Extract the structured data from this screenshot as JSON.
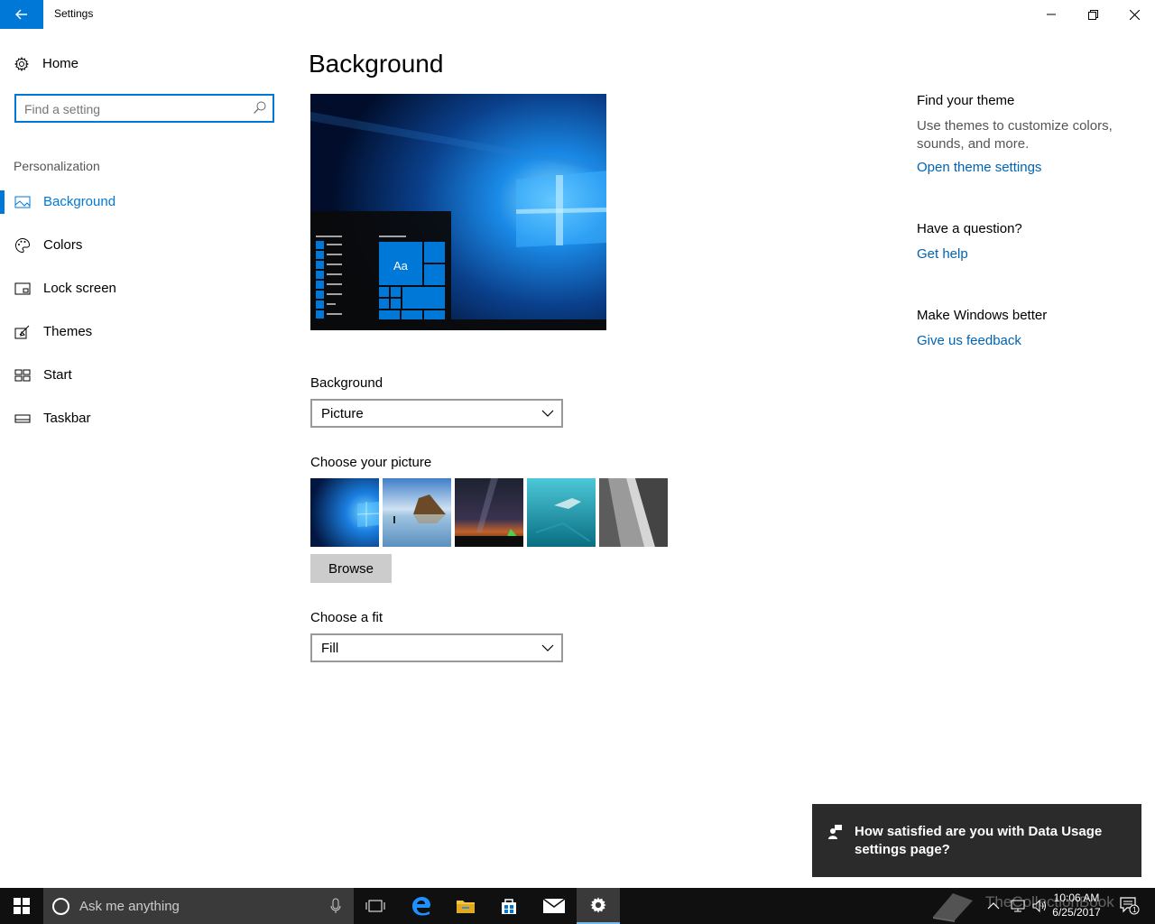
{
  "window": {
    "title": "Settings"
  },
  "sidebar": {
    "home_label": "Home",
    "search_placeholder": "Find a setting",
    "section": "Personalization",
    "items": [
      {
        "label": "Background",
        "icon": "picture-icon",
        "active": true
      },
      {
        "label": "Colors",
        "icon": "palette-icon"
      },
      {
        "label": "Lock screen",
        "icon": "lock-screen-icon"
      },
      {
        "label": "Themes",
        "icon": "themes-icon"
      },
      {
        "label": "Start",
        "icon": "start-icon"
      },
      {
        "label": "Taskbar",
        "icon": "taskbar-icon"
      }
    ]
  },
  "main": {
    "title": "Background",
    "preview_tile_text": "Aa",
    "background_label": "Background",
    "background_value": "Picture",
    "choose_picture_label": "Choose your picture",
    "browse_label": "Browse",
    "fit_label": "Choose a fit",
    "fit_value": "Fill"
  },
  "help": {
    "theme_heading": "Find your theme",
    "theme_text": "Use themes to customize colors, sounds, and more.",
    "theme_link": "Open theme settings",
    "question_heading": "Have a question?",
    "question_link": "Get help",
    "better_heading": "Make Windows better",
    "better_link": "Give us feedback"
  },
  "toast": {
    "message": "How satisfied are you with Data Usage settings page?"
  },
  "taskbar": {
    "search_placeholder": "Ask me anything",
    "time": "10:06 AM",
    "date": "6/25/2017",
    "watermark": "TheCollectionBook",
    "notification_count": "1"
  },
  "colors": {
    "accent": "#0078d7",
    "link": "#0063b1",
    "taskbar": "#101010",
    "toast": "#2b2b2b"
  }
}
